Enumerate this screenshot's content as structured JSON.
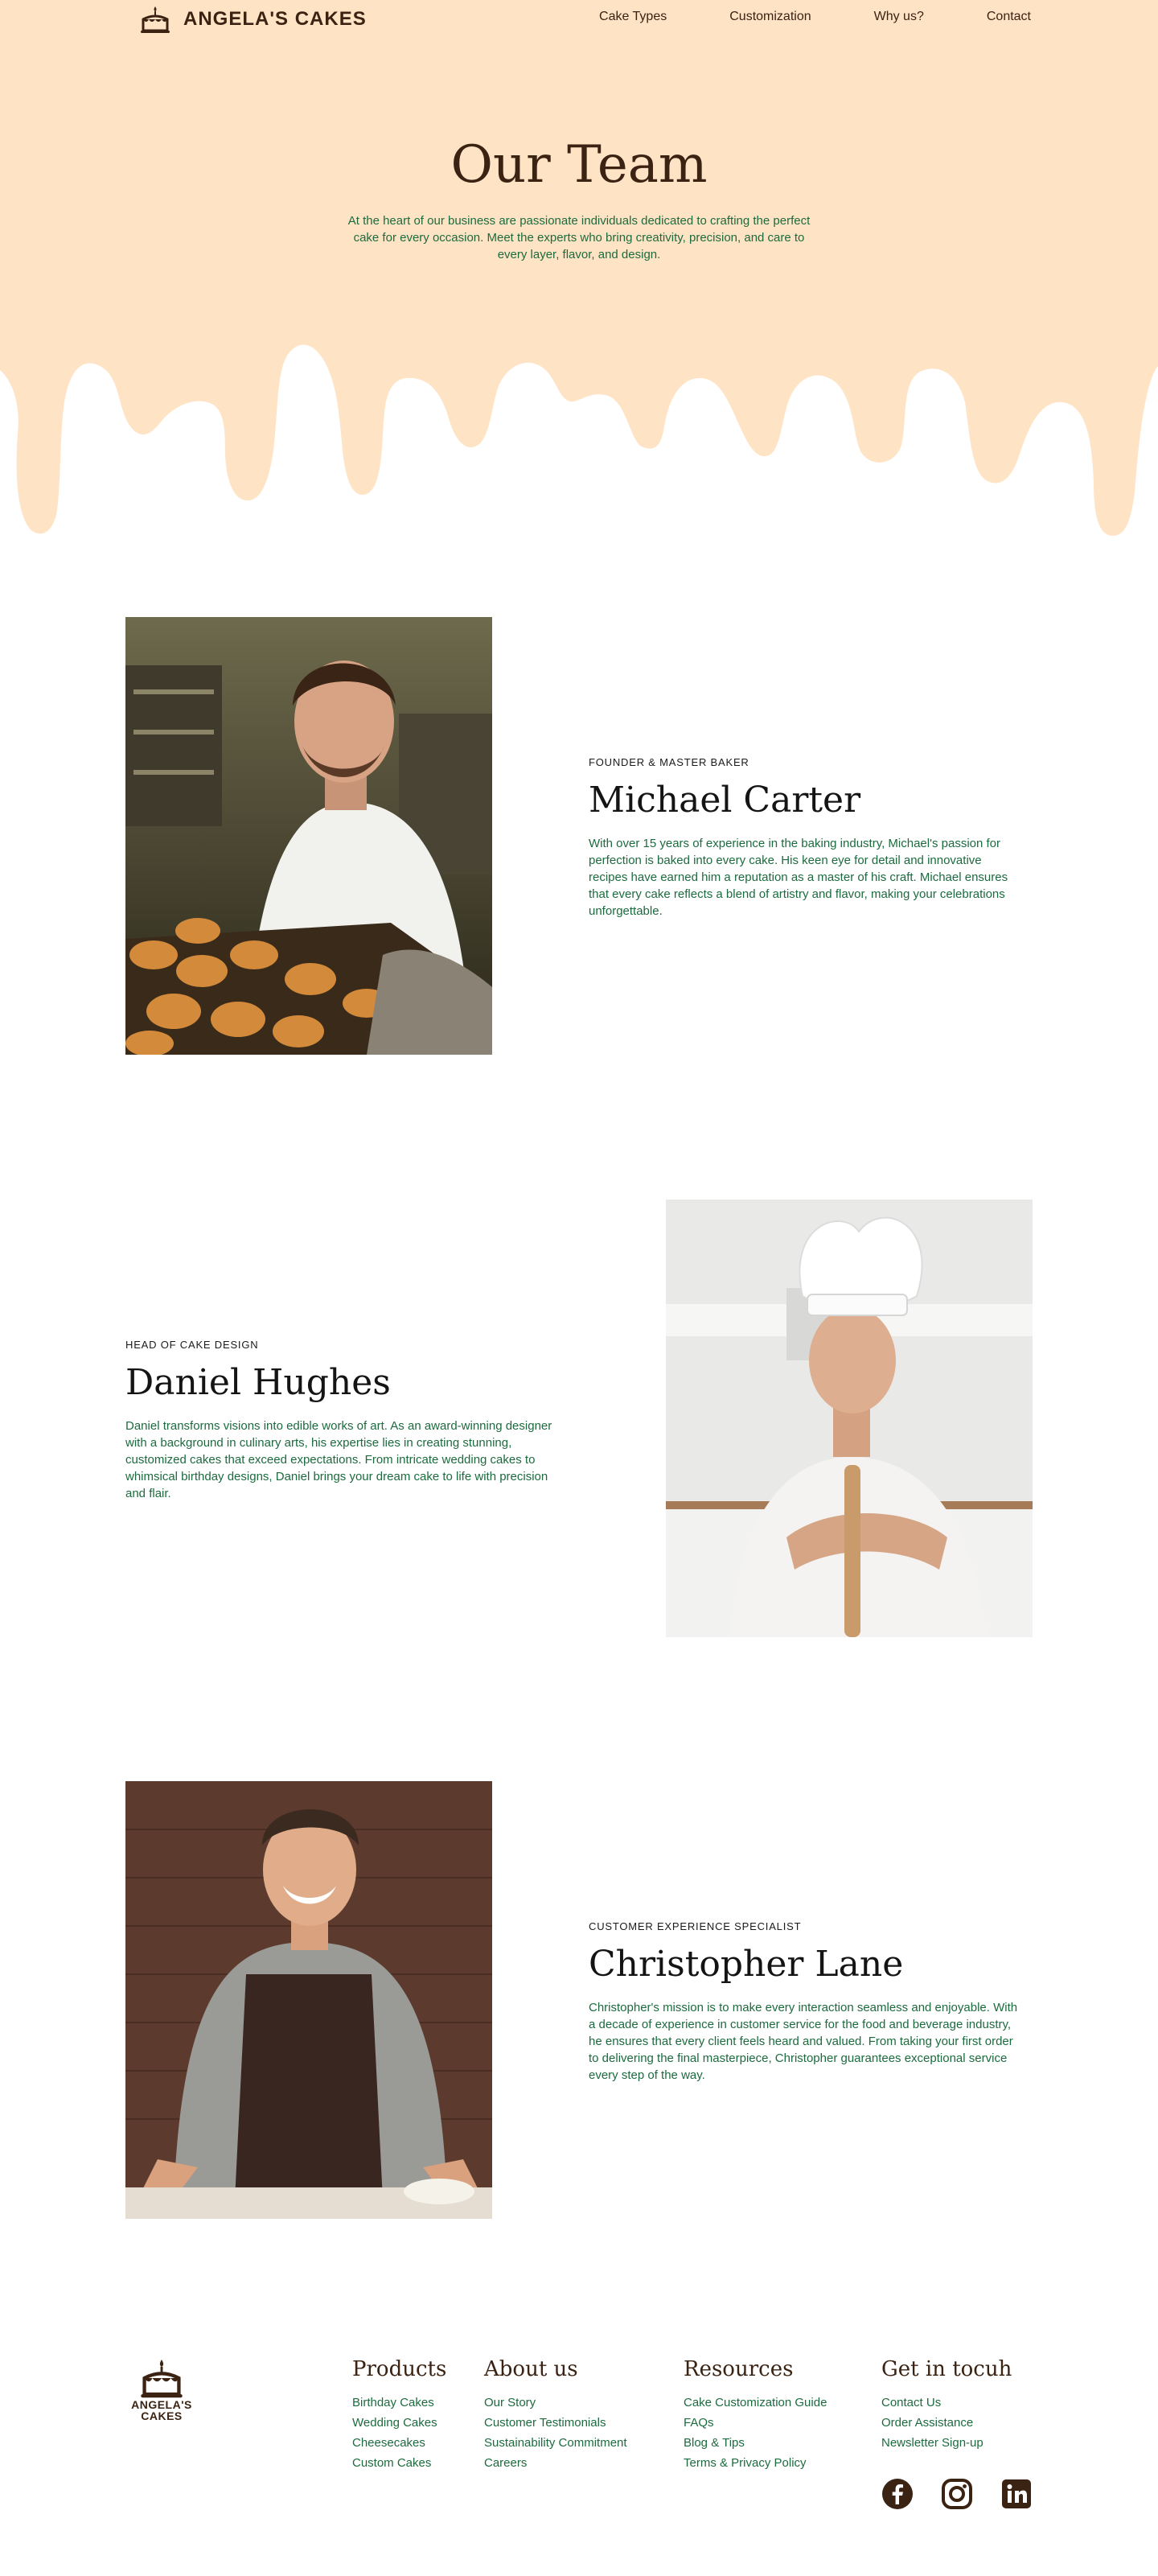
{
  "brand": {
    "name": "ANGELA'S CAKES",
    "icon": "cake-icon"
  },
  "nav": {
    "links": [
      {
        "label": "Cake Types"
      },
      {
        "label": "Customization"
      },
      {
        "label": "Why us?"
      },
      {
        "label": "Contact"
      }
    ]
  },
  "hero": {
    "title": "Our Team",
    "subtitle": "At the heart of our business are passionate individuals dedicated to crafting the perfect cake for every occasion. Meet the experts who bring creativity, precision, and care to every layer, flavor, and design.",
    "background_color": "#FFE3C5"
  },
  "team": [
    {
      "role": "FOUNDER & MASTER BAKER",
      "name": "Michael Carter",
      "bio": "With over 15 years of experience in the baking industry, Michael's passion for perfection is baked into every cake. His keen eye for detail and innovative recipes have earned him a reputation as a master of his craft. Michael ensures that every cake reflects a blend of artistry and flavor, making your celebrations unforgettable."
    },
    {
      "role": "HEAD OF CAKE DESIGN",
      "name": "Daniel Hughes",
      "bio": "Daniel transforms visions into edible works of art. As an award-winning designer with a background in culinary arts, his expertise lies in creating stunning, customized cakes that exceed expectations. From intricate wedding cakes to whimsical birthday designs, Daniel brings your dream cake to life with precision and flair."
    },
    {
      "role": "CUSTOMER EXPERIENCE SPECIALIST",
      "name": "Christopher Lane",
      "bio": "Christopher's mission is to make every interaction seamless and enjoyable. With a decade of experience in customer service for the food and beverage industry, he ensures that every client feels heard and valued. From taking your first order to delivering the final masterpiece, Christopher guarantees exceptional service every step of the way."
    }
  ],
  "footer": {
    "logo_line1": "ANGELA'S",
    "logo_line2": "CAKES",
    "columns": [
      {
        "title": "Products",
        "links": [
          "Birthday Cakes",
          "Wedding Cakes",
          "Cheesecakes",
          "Custom Cakes"
        ]
      },
      {
        "title": "About us",
        "links": [
          "Our Story",
          "Customer Testimonials",
          "Sustainability Commitment",
          "Careers"
        ]
      },
      {
        "title": "Resources",
        "links": [
          "Cake Customization Guide",
          "FAQs",
          "Blog & Tips",
          "Terms & Privacy Policy"
        ]
      },
      {
        "title": "Get in tocuh",
        "links": [
          "Contact Us",
          "Order Assistance",
          "Newsletter Sign-up"
        ]
      }
    ],
    "social_icons": [
      "facebook-icon",
      "instagram-icon",
      "linkedin-icon"
    ]
  },
  "colors": {
    "brown": "#3B2314",
    "green_text": "#1C6B3E",
    "peach": "#FFE3C5"
  }
}
